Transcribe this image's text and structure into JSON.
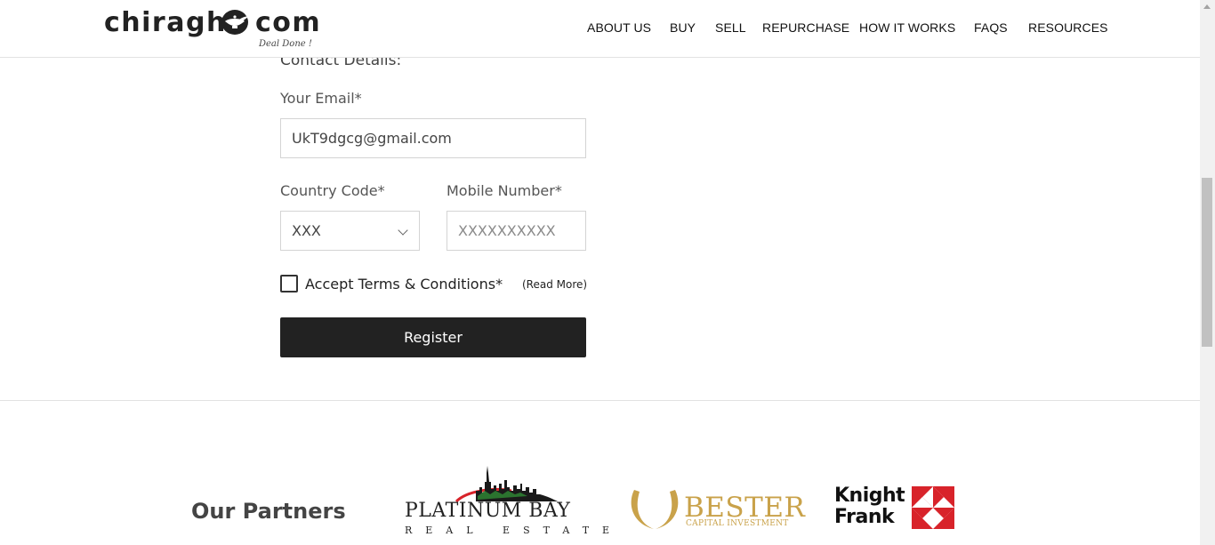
{
  "header": {
    "logo": {
      "left_text": "chiragh",
      "right_text": "com",
      "tagline": "Deal Done !"
    },
    "nav": [
      {
        "label": "ABOUT US"
      },
      {
        "label": "BUY"
      },
      {
        "label": "SELL"
      },
      {
        "label": "REPURCHASE"
      },
      {
        "label": "HOW IT WORKS"
      },
      {
        "label": "FAQS"
      },
      {
        "label": "RESOURCES"
      }
    ]
  },
  "form": {
    "heading": "Contact Details:",
    "email": {
      "label": "Your Email*",
      "value": "UkT9dgcg@gmail.com"
    },
    "country_code": {
      "label": "Country Code*",
      "value": "XXX"
    },
    "mobile": {
      "label": "Mobile Number*",
      "placeholder": "XXXXXXXXXX"
    },
    "terms": {
      "label": "Accept Terms & Conditions*",
      "read_more": "(Read More)",
      "checked": false
    },
    "register_label": "Register"
  },
  "partners": {
    "title": "Our Partners",
    "platinum_bay": {
      "name": "PLATINUM BAY",
      "sub": "REAL ESTATE"
    },
    "bester": {
      "name": "BESTER",
      "sub": "CAPITAL INVESTMENT",
      "color": "#c9a24a"
    },
    "knight_frank": {
      "line1": "Knight",
      "line2": "Frank",
      "color": "#d8232a"
    }
  }
}
